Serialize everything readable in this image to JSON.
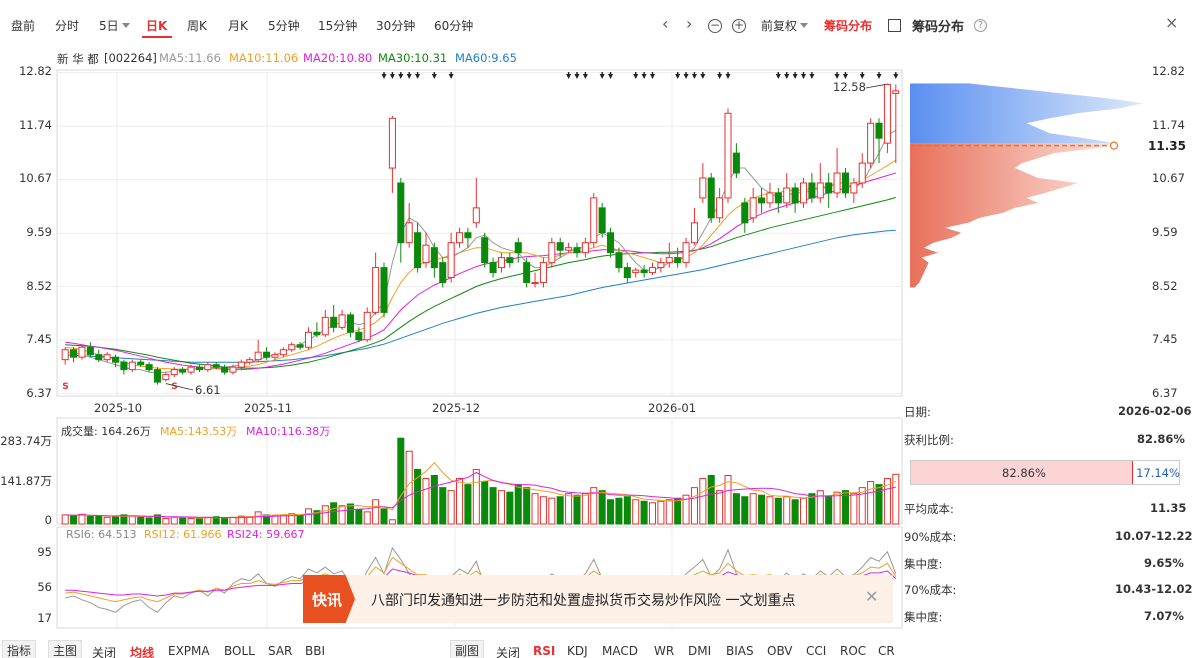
{
  "tabs": [
    {
      "label": "盘前"
    },
    {
      "label": "分时"
    },
    {
      "label": "5日"
    },
    {
      "label": "日K",
      "active": true
    },
    {
      "label": "周K"
    },
    {
      "label": "月K"
    },
    {
      "label": "5分钟"
    },
    {
      "label": "15分钟"
    },
    {
      "label": "30分钟"
    },
    {
      "label": "60分钟"
    }
  ],
  "toolbar": {
    "prev": "‹",
    "next": "›",
    "zoom_out": "−",
    "zoom_in": "+",
    "adjust": "前复权",
    "chip_tab": "筹码分布",
    "chip_title": "筹码分布",
    "help": "?",
    "close": "×"
  },
  "stock": {
    "name": "新 华 都",
    "code": "[002264]",
    "ma5": "MA5:11.66",
    "ma10": "MA10:11.06",
    "ma20": "MA20:10.80",
    "ma30": "MA30:10.31",
    "ma60": "MA60:9.65"
  },
  "colors": {
    "up": "#e93030",
    "down": "#0a8a0a",
    "ma5": "#999999",
    "ma10": "#f0a020",
    "ma20": "#e020e0",
    "ma30": "#118811",
    "ma60": "#2080c0",
    "accent": "#e93030"
  },
  "price_axis": [
    "12.82",
    "11.74",
    "10.67",
    "9.59",
    "8.52",
    "7.45",
    "6.37"
  ],
  "price_range": [
    6.37,
    12.82
  ],
  "date_axis": [
    "2025-10",
    "2025-11",
    "2025-12",
    "2026-01"
  ],
  "annotations": {
    "high": "12.58",
    "low": "6.61"
  },
  "candles": [
    [
      7.05,
      7.25,
      7.3,
      6.95
    ],
    [
      7.25,
      7.1,
      7.3,
      7.0
    ],
    [
      7.1,
      7.3,
      7.35,
      7.05
    ],
    [
      7.3,
      7.15,
      7.4,
      7.1
    ],
    [
      7.15,
      7.05,
      7.25,
      7.0
    ],
    [
      7.05,
      7.15,
      7.2,
      7.0
    ],
    [
      7.1,
      7.0,
      7.15,
      6.9
    ],
    [
      7.0,
      6.85,
      7.05,
      6.75
    ],
    [
      6.85,
      7.0,
      7.05,
      6.8
    ],
    [
      7.0,
      6.95,
      7.05,
      6.9
    ],
    [
      6.95,
      6.85,
      7.0,
      6.8
    ],
    [
      6.85,
      6.6,
      6.9,
      6.55
    ],
    [
      6.65,
      6.75,
      6.8,
      6.61
    ],
    [
      6.75,
      6.85,
      6.9,
      6.7
    ],
    [
      6.85,
      6.8,
      6.9,
      6.75
    ],
    [
      6.8,
      6.9,
      6.95,
      6.75
    ],
    [
      6.9,
      6.85,
      6.95,
      6.8
    ],
    [
      6.85,
      6.95,
      7.0,
      6.8
    ],
    [
      6.95,
      6.9,
      7.0,
      6.85
    ],
    [
      6.9,
      6.8,
      6.95,
      6.75
    ],
    [
      6.8,
      6.9,
      6.95,
      6.75
    ],
    [
      6.9,
      7.0,
      7.05,
      6.85
    ],
    [
      7.0,
      7.05,
      7.1,
      6.95
    ],
    [
      7.05,
      7.2,
      7.45,
      7.0
    ],
    [
      7.2,
      7.1,
      7.3,
      7.05
    ],
    [
      7.1,
      7.15,
      7.2,
      7.05
    ],
    [
      7.15,
      7.25,
      7.3,
      7.1
    ],
    [
      7.25,
      7.35,
      7.4,
      7.2
    ],
    [
      7.35,
      7.3,
      7.4,
      7.25
    ],
    [
      7.3,
      7.6,
      7.7,
      7.25
    ],
    [
      7.6,
      7.55,
      7.8,
      7.5
    ],
    [
      7.55,
      7.9,
      8.05,
      7.5
    ],
    [
      7.9,
      7.7,
      8.15,
      7.6
    ],
    [
      7.7,
      7.95,
      8.05,
      7.65
    ],
    [
      7.95,
      7.6,
      8.0,
      7.5
    ],
    [
      7.6,
      7.45,
      7.7,
      7.4
    ],
    [
      7.45,
      8.0,
      8.1,
      7.4
    ],
    [
      8.0,
      8.9,
      9.2,
      7.95
    ],
    [
      8.9,
      8.0,
      9.0,
      7.9
    ],
    [
      10.9,
      11.9,
      11.95,
      10.4
    ],
    [
      10.6,
      9.4,
      10.7,
      9.0
    ],
    [
      9.4,
      9.8,
      10.2,
      9.3
    ],
    [
      9.6,
      8.9,
      9.8,
      8.8
    ],
    [
      9.0,
      9.35,
      9.6,
      8.9
    ],
    [
      9.3,
      8.9,
      9.4,
      8.7
    ],
    [
      9.0,
      8.6,
      9.1,
      8.5
    ],
    [
      8.7,
      9.4,
      9.6,
      8.6
    ],
    [
      9.4,
      9.6,
      9.7,
      9.3
    ],
    [
      9.6,
      9.5,
      9.7,
      9.3
    ],
    [
      9.8,
      10.1,
      10.7,
      9.7
    ],
    [
      9.5,
      9.0,
      9.6,
      8.9
    ],
    [
      9.0,
      8.8,
      9.1,
      8.7
    ],
    [
      8.9,
      9.1,
      9.2,
      8.8
    ],
    [
      9.1,
      9.0,
      9.2,
      8.9
    ],
    [
      9.4,
      9.2,
      9.5,
      9.0
    ],
    [
      9.0,
      8.6,
      9.1,
      8.5
    ],
    [
      8.6,
      8.6,
      8.8,
      8.5
    ],
    [
      8.6,
      9.0,
      9.1,
      8.5
    ],
    [
      9.0,
      9.4,
      9.5,
      8.9
    ],
    [
      9.4,
      9.25,
      9.5,
      9.1
    ],
    [
      9.25,
      9.3,
      9.4,
      9.2
    ],
    [
      9.3,
      9.2,
      9.4,
      9.1
    ],
    [
      9.2,
      9.4,
      9.5,
      9.1
    ],
    [
      9.4,
      10.3,
      10.4,
      9.3
    ],
    [
      10.1,
      9.6,
      10.2,
      9.5
    ],
    [
      9.6,
      9.2,
      9.7,
      9.1
    ],
    [
      9.2,
      8.9,
      9.3,
      8.8
    ],
    [
      8.9,
      8.7,
      9.0,
      8.6
    ],
    [
      8.8,
      8.85,
      8.9,
      8.7
    ],
    [
      8.85,
      8.8,
      8.95,
      8.7
    ],
    [
      8.8,
      8.9,
      9.0,
      8.75
    ],
    [
      8.9,
      9.0,
      9.1,
      8.8
    ],
    [
      9.0,
      9.1,
      9.4,
      8.9
    ],
    [
      9.1,
      9.0,
      9.3,
      8.9
    ],
    [
      9.0,
      9.4,
      9.5,
      8.9
    ],
    [
      9.4,
      9.8,
      10.1,
      9.35
    ],
    [
      10.3,
      10.7,
      11.0,
      10.2
    ],
    [
      10.7,
      9.9,
      10.8,
      9.8
    ],
    [
      9.9,
      10.3,
      10.5,
      9.8
    ],
    [
      10.3,
      12.0,
      12.1,
      10.2
    ],
    [
      11.2,
      10.8,
      11.4,
      10.7
    ],
    [
      10.2,
      9.8,
      10.3,
      9.6
    ],
    [
      9.9,
      10.3,
      10.5,
      9.8
    ],
    [
      10.3,
      10.2,
      10.5,
      10.0
    ],
    [
      10.2,
      10.4,
      10.6,
      10.1
    ],
    [
      10.4,
      10.2,
      10.5,
      10.0
    ],
    [
      10.2,
      10.5,
      10.8,
      10.1
    ],
    [
      10.5,
      10.2,
      10.6,
      10.0
    ],
    [
      10.2,
      10.6,
      10.7,
      10.1
    ],
    [
      10.6,
      10.3,
      10.8,
      10.2
    ],
    [
      10.3,
      10.6,
      11.0,
      10.2
    ],
    [
      10.6,
      10.4,
      10.8,
      10.1
    ],
    [
      10.4,
      10.8,
      11.3,
      10.3
    ],
    [
      10.8,
      10.4,
      10.9,
      10.3
    ],
    [
      10.4,
      10.6,
      10.7,
      10.2
    ],
    [
      10.6,
      11.0,
      11.2,
      10.5
    ],
    [
      11.0,
      11.8,
      11.9,
      10.9
    ],
    [
      11.8,
      11.5,
      11.9,
      11.0
    ],
    [
      11.4,
      12.58,
      12.6,
      11.2
    ],
    [
      12.4,
      12.45,
      12.58,
      11.0
    ]
  ],
  "ma_series": {
    "ma5": [
      7.2,
      7.2,
      7.15,
      7.1,
      7.05,
      7.0,
      6.95,
      6.9,
      6.85,
      6.85,
      6.8,
      6.78,
      6.8,
      6.82,
      6.85,
      6.86,
      6.87,
      6.88,
      6.9,
      6.9,
      6.92,
      6.95,
      7.0,
      7.05,
      7.1,
      7.15,
      7.2,
      7.28,
      7.35,
      7.45,
      7.55,
      7.65,
      7.75,
      7.8,
      7.8,
      7.75,
      7.8,
      8.0,
      8.2,
      9.0,
      9.6,
      9.9,
      9.8,
      9.6,
      9.3,
      9.1,
      9.1,
      9.2,
      9.3,
      9.5,
      9.55,
      9.4,
      9.3,
      9.25,
      9.2,
      9.0,
      8.9,
      8.9,
      9.0,
      9.1,
      9.2,
      9.3,
      9.3,
      9.5,
      9.6,
      9.5,
      9.4,
      9.2,
      9.0,
      8.85,
      8.85,
      8.9,
      9.0,
      9.05,
      9.15,
      9.3,
      9.6,
      9.9,
      10.2,
      10.6,
      10.9,
      10.9,
      10.7,
      10.5,
      10.4,
      10.3,
      10.35,
      10.4,
      10.4,
      10.45,
      10.5,
      10.5,
      10.6,
      10.6,
      10.5,
      10.6,
      10.9,
      11.2,
      11.55,
      11.66
    ],
    "ma10": [
      7.3,
      7.28,
      7.25,
      7.2,
      7.15,
      7.1,
      7.05,
      7.0,
      6.95,
      6.92,
      6.9,
      6.88,
      6.87,
      6.86,
      6.86,
      6.86,
      6.86,
      6.87,
      6.88,
      6.88,
      6.89,
      6.9,
      6.92,
      6.95,
      7.0,
      7.05,
      7.1,
      7.15,
      7.2,
      7.25,
      7.32,
      7.4,
      7.48,
      7.55,
      7.6,
      7.65,
      7.7,
      7.8,
      7.95,
      8.3,
      8.6,
      8.8,
      8.95,
      9.0,
      9.05,
      9.1,
      9.15,
      9.2,
      9.25,
      9.3,
      9.3,
      9.25,
      9.2,
      9.2,
      9.2,
      9.2,
      9.15,
      9.1,
      9.1,
      9.15,
      9.2,
      9.2,
      9.25,
      9.3,
      9.35,
      9.3,
      9.25,
      9.2,
      9.15,
      9.1,
      9.05,
      9.0,
      9.0,
      9.05,
      9.1,
      9.2,
      9.35,
      9.55,
      9.75,
      9.95,
      10.1,
      10.2,
      10.3,
      10.35,
      10.4,
      10.4,
      10.45,
      10.45,
      10.45,
      10.5,
      10.5,
      10.55,
      10.6,
      10.6,
      10.6,
      10.65,
      10.75,
      10.85,
      10.95,
      11.06
    ],
    "ma20": [
      7.4,
      7.38,
      7.35,
      7.32,
      7.3,
      7.27,
      7.24,
      7.2,
      7.16,
      7.12,
      7.08,
      7.04,
      7.0,
      6.97,
      6.94,
      6.92,
      6.9,
      6.88,
      6.87,
      6.86,
      6.85,
      6.85,
      6.86,
      6.88,
      6.9,
      6.93,
      6.96,
      7.0,
      7.04,
      7.08,
      7.13,
      7.18,
      7.24,
      7.3,
      7.36,
      7.42,
      7.48,
      7.56,
      7.65,
      7.85,
      8.05,
      8.2,
      8.35,
      8.45,
      8.55,
      8.62,
      8.7,
      8.78,
      8.85,
      8.92,
      8.97,
      9.0,
      9.03,
      9.06,
      9.1,
      9.12,
      9.13,
      9.14,
      9.16,
      9.18,
      9.2,
      9.21,
      9.22,
      9.24,
      9.26,
      9.26,
      9.25,
      9.24,
      9.22,
      9.2,
      9.19,
      9.18,
      9.18,
      9.19,
      9.21,
      9.24,
      9.3,
      9.38,
      9.48,
      9.6,
      9.72,
      9.82,
      9.9,
      9.98,
      10.05,
      10.1,
      10.15,
      10.2,
      10.25,
      10.3,
      10.35,
      10.4,
      10.45,
      10.5,
      10.55,
      10.6,
      10.65,
      10.7,
      10.75,
      10.8
    ],
    "ma30": [
      7.35,
      7.34,
      7.33,
      7.32,
      7.3,
      7.28,
      7.26,
      7.23,
      7.2,
      7.17,
      7.14,
      7.1,
      7.07,
      7.04,
      7.01,
      6.98,
      6.96,
      6.94,
      6.92,
      6.9,
      6.89,
      6.88,
      6.88,
      6.88,
      6.89,
      6.9,
      6.92,
      6.94,
      6.97,
      7.0,
      7.04,
      7.08,
      7.13,
      7.18,
      7.23,
      7.28,
      7.33,
      7.39,
      7.46,
      7.58,
      7.7,
      7.82,
      7.93,
      8.03,
      8.12,
      8.2,
      8.28,
      8.36,
      8.44,
      8.52,
      8.58,
      8.63,
      8.68,
      8.72,
      8.76,
      8.8,
      8.84,
      8.88,
      8.92,
      8.96,
      9.0,
      9.03,
      9.06,
      9.1,
      9.13,
      9.15,
      9.17,
      9.18,
      9.19,
      9.2,
      9.2,
      9.21,
      9.21,
      9.22,
      9.23,
      9.25,
      9.28,
      9.32,
      9.38,
      9.44,
      9.5,
      9.55,
      9.6,
      9.65,
      9.7,
      9.74,
      9.78,
      9.82,
      9.86,
      9.9,
      9.94,
      9.98,
      10.02,
      10.06,
      10.1,
      10.14,
      10.18,
      10.22,
      10.26,
      10.31
    ],
    "ma60": [
      7.15,
      7.14,
      7.13,
      7.12,
      7.11,
      7.1,
      7.09,
      7.08,
      7.07,
      7.06,
      7.05,
      7.04,
      7.03,
      7.02,
      7.01,
      7.0,
      7.0,
      7.0,
      7.0,
      7.0,
      7.0,
      7.0,
      7.0,
      7.01,
      7.02,
      7.03,
      7.04,
      7.05,
      7.07,
      7.09,
      7.11,
      7.13,
      7.16,
      7.19,
      7.22,
      7.25,
      7.28,
      7.32,
      7.36,
      7.42,
      7.48,
      7.54,
      7.6,
      7.66,
      7.72,
      7.78,
      7.83,
      7.88,
      7.93,
      7.98,
      8.02,
      8.06,
      8.1,
      8.13,
      8.16,
      8.19,
      8.22,
      8.25,
      8.28,
      8.31,
      8.34,
      8.38,
      8.42,
      8.46,
      8.5,
      8.53,
      8.56,
      8.59,
      8.62,
      8.65,
      8.68,
      8.71,
      8.74,
      8.77,
      8.8,
      8.83,
      8.86,
      8.9,
      8.94,
      8.98,
      9.02,
      9.06,
      9.1,
      9.14,
      9.18,
      9.22,
      9.26,
      9.3,
      9.34,
      9.38,
      9.42,
      9.46,
      9.5,
      9.53,
      9.56,
      9.58,
      9.6,
      9.62,
      9.64,
      9.65
    ]
  },
  "signal_markers": [
    38,
    39,
    40,
    41,
    42,
    44,
    46,
    60,
    61,
    62,
    64,
    65,
    68,
    69,
    70,
    73,
    74,
    75,
    76,
    78,
    79,
    85,
    86,
    87,
    88,
    89,
    92,
    93,
    95,
    97,
    99
  ],
  "volume": {
    "label": "成交量: 164.26万",
    "ma5": "MA5:143.53万",
    "ma10": "MA10:116.38万",
    "axis": [
      "283.74万",
      "141.87万",
      "0"
    ],
    "max": 283.74,
    "values": [
      30,
      28,
      32,
      25,
      26,
      22,
      24,
      30,
      26,
      22,
      20,
      30,
      18,
      22,
      20,
      18,
      20,
      22,
      24,
      20,
      22,
      26,
      24,
      40,
      30,
      28,
      30,
      34,
      30,
      50,
      44,
      60,
      70,
      60,
      66,
      48,
      40,
      80,
      50,
      14,
      283,
      240,
      180,
      150,
      160,
      120,
      110,
      150,
      130,
      180,
      140,
      120,
      110,
      105,
      130,
      120,
      100,
      90,
      85,
      90,
      100,
      95,
      100,
      120,
      110,
      80,
      85,
      90,
      80,
      75,
      70,
      75,
      80,
      85,
      95,
      120,
      150,
      160,
      110,
      160,
      100,
      90,
      100,
      95,
      90,
      85,
      90,
      80,
      85,
      100,
      110,
      90,
      105,
      110,
      100,
      120,
      140,
      130,
      150,
      164
    ]
  },
  "rsi": {
    "rsi6": "RSI6: 64.513",
    "rsi12": "RSI12: 61.966",
    "rsi24": "RSI24: 59.667",
    "axis": [
      "95",
      "56",
      "17"
    ],
    "s6": [
      40,
      42,
      38,
      35,
      30,
      28,
      25,
      32,
      36,
      38,
      30,
      25,
      35,
      42,
      40,
      45,
      48,
      42,
      50,
      45,
      55,
      60,
      58,
      65,
      55,
      52,
      58,
      62,
      60,
      70,
      66,
      72,
      65,
      68,
      55,
      50,
      68,
      82,
      65,
      92,
      80,
      65,
      55,
      60,
      50,
      45,
      62,
      70,
      65,
      78,
      52,
      45,
      55,
      52,
      60,
      45,
      46,
      58,
      65,
      60,
      62,
      58,
      65,
      80,
      60,
      50,
      45,
      42,
      48,
      46,
      52,
      56,
      60,
      55,
      65,
      72,
      80,
      62,
      70,
      90,
      65,
      55,
      62,
      60,
      64,
      58,
      66,
      58,
      65,
      60,
      68,
      62,
      70,
      62,
      64,
      72,
      82,
      78,
      88,
      65
    ],
    "s12": [
      45,
      46,
      44,
      42,
      40,
      38,
      36,
      38,
      40,
      41,
      38,
      36,
      40,
      44,
      44,
      46,
      48,
      46,
      50,
      48,
      52,
      55,
      55,
      58,
      55,
      54,
      56,
      58,
      58,
      63,
      62,
      65,
      62,
      63,
      58,
      56,
      62,
      72,
      66,
      82,
      76,
      70,
      64,
      64,
      60,
      56,
      60,
      64,
      62,
      68,
      60,
      56,
      58,
      56,
      58,
      53,
      53,
      56,
      60,
      59,
      60,
      58,
      61,
      68,
      62,
      58,
      55,
      53,
      54,
      53,
      55,
      57,
      58,
      57,
      60,
      64,
      68,
      64,
      66,
      76,
      68,
      63,
      64,
      63,
      64,
      61,
      63,
      60,
      62,
      61,
      64,
      62,
      64,
      62,
      63,
      66,
      72,
      71,
      76,
      62
    ],
    "s24": [
      48,
      48,
      47,
      46,
      45,
      44,
      43,
      43,
      44,
      44,
      43,
      42,
      43,
      45,
      45,
      46,
      47,
      47,
      48,
      48,
      50,
      51,
      52,
      53,
      53,
      53,
      54,
      55,
      55,
      57,
      57,
      59,
      58,
      59,
      57,
      56,
      58,
      63,
      61,
      70,
      68,
      66,
      63,
      63,
      61,
      59,
      60,
      61,
      61,
      63,
      60,
      58,
      58,
      58,
      58,
      56,
      56,
      57,
      58,
      58,
      58,
      58,
      59,
      62,
      60,
      58,
      57,
      56,
      56,
      55,
      56,
      56,
      57,
      57,
      58,
      60,
      62,
      61,
      62,
      67,
      64,
      61,
      62,
      62,
      62,
      61,
      61,
      60,
      61,
      60,
      62,
      61,
      62,
      61,
      62,
      63,
      66,
      66,
      68,
      60
    ]
  },
  "news": {
    "tag": "快讯",
    "text": "八部门印发通知进一步防范和处置虚拟货币交易炒作风险 一文划重点",
    "close": "✕"
  },
  "chip": {
    "avg_cost_marker": "11.35",
    "date_label": "日期:",
    "date_value": "2026-02-06",
    "profit_label": "获利比例:",
    "profit_value": "82.86%",
    "bar_profit": "82.86%",
    "bar_loss": "17.14%",
    "profit_ratio": 0.8286,
    "avg_label": "平均成本:",
    "avg_value": "11.35",
    "c90_label": "90%成本:",
    "c90_value": "10.07-12.22",
    "conc90_label": "集中度:",
    "conc90_value": "9.65%",
    "c70_label": "70%成本:",
    "c70_value": "10.43-12.02",
    "conc70_label": "集中度:",
    "conc70_value": "7.07%",
    "distribution_price": [
      8.5,
      8.6,
      8.8,
      9.0,
      9.1,
      9.2,
      9.3,
      9.4,
      9.5,
      9.6,
      9.7,
      9.8,
      9.9,
      10.0,
      10.1,
      10.2,
      10.3,
      10.4,
      10.5,
      10.6,
      10.7,
      10.8,
      10.9,
      11.0,
      11.1,
      11.2,
      11.3,
      11.4,
      11.5,
      11.6,
      11.7,
      11.8,
      11.9,
      12.0,
      12.1,
      12.2,
      12.3,
      12.4,
      12.5,
      12.6
    ],
    "distribution_value": [
      0.02,
      0.04,
      0.06,
      0.08,
      0.05,
      0.12,
      0.06,
      0.1,
      0.18,
      0.22,
      0.15,
      0.25,
      0.3,
      0.4,
      0.45,
      0.55,
      0.5,
      0.58,
      0.65,
      0.72,
      0.55,
      0.5,
      0.45,
      0.48,
      0.55,
      0.62,
      0.8,
      0.88,
      0.75,
      0.6,
      0.55,
      0.5,
      0.6,
      0.72,
      0.9,
      1.0,
      0.85,
      0.65,
      0.45,
      0.25
    ]
  },
  "bottom": {
    "left": [
      "指标",
      "主图",
      "关闭",
      "均线",
      "EXPMA",
      "BOLL",
      "SAR",
      "BBI"
    ],
    "right": [
      "副图",
      "关闭",
      "RSI",
      "KDJ",
      "MACD",
      "WR",
      "DMI",
      "BIAS",
      "OBV",
      "CCI",
      "ROC",
      "CR"
    ]
  }
}
